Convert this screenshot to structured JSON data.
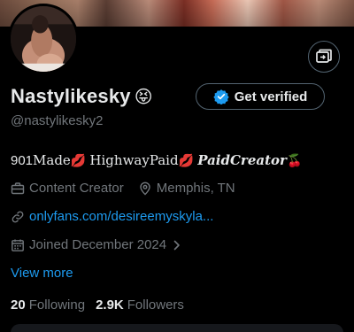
{
  "profile": {
    "display_name": "Nastylikesky",
    "name_emoji": "😝",
    "handle": "@nastylikesky2",
    "verify_label": "Get verified",
    "bio": {
      "p1": "901",
      "p2": "Made",
      "e1": "💋",
      "p3": "HighwayPaid",
      "e2": "💋",
      "p4": "PaidCreator",
      "e3": "🍒"
    },
    "category": "Content Creator",
    "location": "Memphis, TN",
    "website": "onlyfans.com/desireemyskyla...",
    "joined": "Joined December 2024",
    "view_more": "View more",
    "following_count": "20",
    "following_label": "Following",
    "followers_count": "2.9K",
    "followers_label": "Followers"
  },
  "icons": {
    "top_action": "switch-profile-icon",
    "verified": "verified-badge-icon",
    "category": "briefcase-icon",
    "location": "location-pin-icon",
    "website": "link-icon",
    "joined": "calendar-icon",
    "chevron": "chevron-right-icon"
  },
  "colors": {
    "background": "#000000",
    "text_primary": "#e7e9ea",
    "text_secondary": "#71767b",
    "accent": "#1d9bf0",
    "border": "#536471"
  }
}
